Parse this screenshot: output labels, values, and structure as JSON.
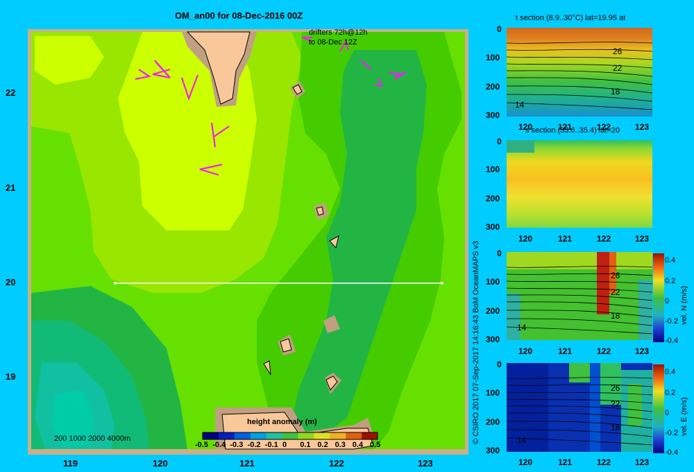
{
  "map": {
    "title": "OM_an00 for 08-Dec-2016 00Z",
    "drifter_note_line1": "drifters 72h@12h",
    "drifter_note_line2": "to 08-Dec 12Z",
    "lat_ticks": [
      "22",
      "21",
      "20",
      "19"
    ],
    "lon_ticks": [
      "119",
      "120",
      "121",
      "122",
      "123"
    ],
    "depth_scale_label": "200  1000  2000  4000m",
    "section_line_latitude": 20,
    "colorbar": {
      "title": "height anomaly (m)",
      "ticks": [
        "-0.5",
        "-0.4",
        "-0.3",
        "-0.2",
        "-0.1",
        "0",
        "0.1",
        "0.2",
        "0.3",
        "0.4",
        "0.5"
      ]
    },
    "colors": {
      "background": "#00ccff",
      "land": "#f9c89a",
      "shelf": "#c0a080",
      "drifter": "#ee22ee",
      "section_line": "#ffffff"
    }
  },
  "credit": "© CSIRO 2017   07-Sep-2017 14:16:43 BoM OceanMAPS v3",
  "panels": [
    {
      "title": "t section (8.9..30°C) lat=19.95 at",
      "y_ticks": [
        "0",
        "100",
        "200",
        "300"
      ],
      "x_ticks": [
        "120",
        "121",
        "122",
        "123"
      ],
      "contour_labels": [
        "26",
        "22",
        "18",
        "14"
      ]
    },
    {
      "title": "s section (33.6..35.4) lat=20",
      "y_ticks": [
        "0",
        "100",
        "200",
        "300"
      ],
      "x_ticks": [
        "120",
        "121",
        "122",
        "123"
      ],
      "contour_labels": []
    },
    {
      "title": "",
      "y_ticks": [
        "0",
        "100",
        "200",
        "300"
      ],
      "x_ticks": [
        "120",
        "121",
        "122",
        "123"
      ],
      "contour_labels": [
        "26",
        "22",
        "18",
        "14"
      ],
      "colorbar_label": "vel. N (m/s)",
      "colorbar_ticks": [
        "0.4",
        "0.2",
        "0",
        "-0.2",
        "-0.4"
      ]
    },
    {
      "title": "",
      "y_ticks": [
        "0",
        "100",
        "200",
        "300"
      ],
      "x_ticks": [
        "120",
        "121",
        "122",
        "123"
      ],
      "contour_labels": [
        "26",
        "22",
        "18",
        "14"
      ],
      "colorbar_label": "vel. E (m/s)",
      "colorbar_ticks": [
        "0.4",
        "0.2",
        "0",
        "-0.2",
        "-0.4"
      ]
    }
  ]
}
